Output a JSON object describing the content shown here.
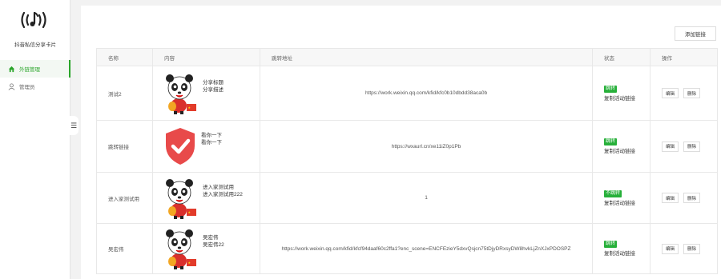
{
  "app": {
    "title": "抖音私信分享卡片",
    "logo_icon": "sound-wave-icon"
  },
  "sidebar": {
    "items": [
      {
        "label": "外链管理",
        "icon": "home-icon",
        "active": true
      },
      {
        "label": "管理员",
        "icon": "user-icon",
        "active": false
      }
    ],
    "collapse_icon": "menu-icon"
  },
  "toolbar": {
    "add_label": "添加链接"
  },
  "table": {
    "headers": {
      "name": "名称",
      "content": "内容",
      "url": "跳转地址",
      "status": "状态",
      "ops": "操作"
    },
    "rows": [
      {
        "name": "测试2",
        "thumb": "panda-mascot-image",
        "title": "分享标题",
        "desc": "分享描述",
        "url": "https://work.weixin.qq.com/kfid/kfc0b10dbdd38aca0b",
        "badge": "跳转",
        "status_text": "复制活动链接",
        "edit_label": "编辑",
        "delete_label": "删除"
      },
      {
        "name": "跳转链接",
        "thumb": "shield-check-icon",
        "title": "看你一下",
        "desc": "看你一下",
        "url": "https://wxaurl.cn/xe11iZ0p1Pb",
        "badge": "跳转",
        "status_text": "复制活动链接",
        "edit_label": "编辑",
        "delete_label": "删除"
      },
      {
        "name": "进入家测试用",
        "thumb": "panda-mascot-image",
        "title": "进入家测试用",
        "desc": "进入家测试用222",
        "url": "1",
        "badge": "不跳转",
        "status_text": "复制活动链接",
        "edit_label": "编辑",
        "delete_label": "删除"
      },
      {
        "name": "吴宏伟",
        "thumb": "panda-mascot-image",
        "title": "吴宏伟",
        "desc": "吴宏伟22",
        "url": "https://work.weixin.qq.com/kfid/kfcf94daaf60c2ffa1?enc_scene=ENCFEzieY5dxvQsjcn75tDjyDRxsyDW8hvkLjZnXJxPDOSPZ",
        "badge": "跳转",
        "status_text": "复制活动链接",
        "edit_label": "编辑",
        "delete_label": "删除"
      }
    ]
  },
  "colors": {
    "accent": "#2aa52a",
    "badge": "#27b03a",
    "shield": "#e84a4a"
  }
}
